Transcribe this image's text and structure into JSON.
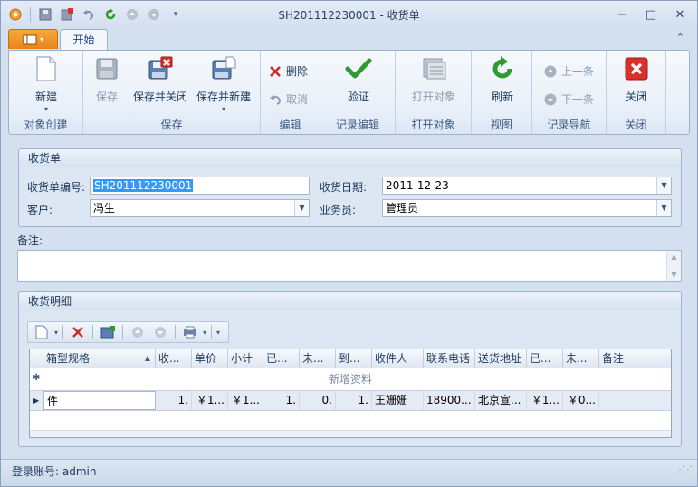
{
  "window": {
    "title": "SH201112230001 - 收货单",
    "minimize": "−",
    "maximize": "□",
    "close": "✕"
  },
  "tabs": {
    "start": "开始"
  },
  "ribbon": {
    "new": "新建",
    "save": "保存",
    "save_close": "保存并关闭",
    "save_new": "保存并新建",
    "delete": "删除",
    "cancel": "取消",
    "validate": "验证",
    "open_object": "打开对象",
    "refresh": "刷新",
    "prev": "上一条",
    "next": "下一条",
    "close": "关闭",
    "groups": {
      "create": "对象创建",
      "save": "保存",
      "edit": "编辑",
      "record_edit": "记录编辑",
      "open": "打开对象",
      "view": "视图",
      "nav": "记录导航",
      "close": "关闭"
    }
  },
  "form": {
    "section_title": "收货单",
    "number_label": "收货单编号:",
    "number_value": "SH201112230001",
    "date_label": "收货日期:",
    "date_value": "2011-12-23",
    "customer_label": "客户:",
    "customer_value": "冯生",
    "salesman_label": "业务员:",
    "salesman_value": "管理员",
    "remark_label": "备注:",
    "remark_value": ""
  },
  "details": {
    "section_title": "收货明细",
    "new_row_text": "新增资料",
    "columns": [
      "箱型规格",
      "收...",
      "单价",
      "小计",
      "已...",
      "未...",
      "到...",
      "收件人",
      "联系电话",
      "送货地址",
      "已...",
      "未...",
      "备注"
    ],
    "rows": [
      [
        "件",
        "1.",
        "￥1...",
        "￥1...",
        "1.",
        "0.",
        "1.",
        "王姗姗",
        "18900...",
        "北京宣...",
        "￥1...",
        "￥0...",
        ""
      ]
    ]
  },
  "status": {
    "login_label": "登录账号:",
    "login_value": "admin"
  },
  "colors": {
    "accent": "#e8851a",
    "ribbon_bg": "#e9f0f9",
    "selection": "#3399ff"
  }
}
